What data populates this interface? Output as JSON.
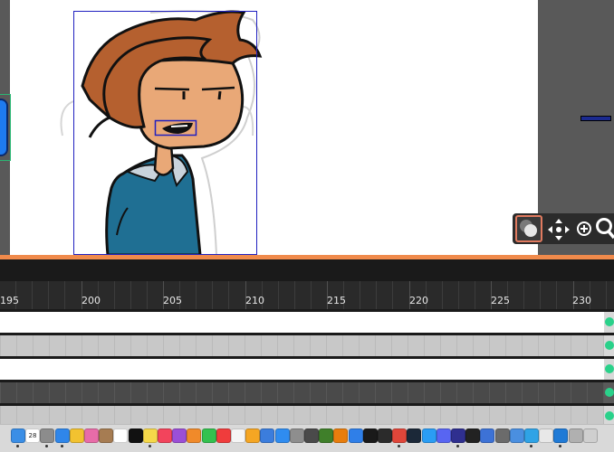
{
  "timeline": {
    "ruler_labels": [
      "195",
      "200",
      "205",
      "210",
      "215",
      "220",
      "225",
      "230"
    ]
  },
  "tracks": [
    "white",
    "grey",
    "white",
    "dark",
    "grey"
  ],
  "colors": {
    "accent": "#f08a4b",
    "keyframe": "#2ad18a",
    "selection": "#2020c0",
    "hair": "#b5602f",
    "skin": "#e9a877",
    "hoodie": "#1f6f93"
  },
  "tool_widget": {
    "icons": [
      "onion-skin-icon",
      "move-arrows-icon",
      "zoom-in-icon",
      "search-icon"
    ]
  },
  "dock": {
    "apps": [
      {
        "name": "finder-icon",
        "color": "#3a8ee6"
      },
      {
        "name": "calendar-icon",
        "color": "#ffffff",
        "text": "28"
      },
      {
        "name": "launchpad-icon",
        "color": "#8c8c8c"
      },
      {
        "name": "mail-icon",
        "color": "#2f86ea"
      },
      {
        "name": "chrome-icon",
        "color": "#f2c230"
      },
      {
        "name": "photos-icon",
        "color": "#e86ca8"
      },
      {
        "name": "notes-icon",
        "color": "#a67c52"
      },
      {
        "name": "reminders-icon",
        "color": "#ffffff"
      },
      {
        "name": "appletv-icon",
        "color": "#111111"
      },
      {
        "name": "stickies-icon",
        "color": "#f5d84a"
      },
      {
        "name": "music-icon",
        "color": "#f2445c"
      },
      {
        "name": "podcasts-icon",
        "color": "#9b4fd6"
      },
      {
        "name": "books-icon",
        "color": "#f08a2a"
      },
      {
        "name": "facetime-icon",
        "color": "#33c14f"
      },
      {
        "name": "news-icon",
        "color": "#f03c3c"
      },
      {
        "name": "script-icon",
        "color": "#f5f5f5"
      },
      {
        "name": "pages-icon",
        "color": "#f5a623"
      },
      {
        "name": "keynote-icon",
        "color": "#3b7ddd"
      },
      {
        "name": "appstore-icon",
        "color": "#2f8cf0"
      },
      {
        "name": "system-settings-icon",
        "color": "#8e8e8e"
      },
      {
        "name": "activity-icon",
        "color": "#4a4a4a"
      },
      {
        "name": "minecraft-icon",
        "color": "#3f7f2a"
      },
      {
        "name": "blender-icon",
        "color": "#e87d0d"
      },
      {
        "name": "bluetooth-icon",
        "color": "#2f7fe8"
      },
      {
        "name": "terminal-icon",
        "color": "#1a1a1a"
      },
      {
        "name": "tv-icon",
        "color": "#2b2b2b"
      },
      {
        "name": "chrome2-icon",
        "color": "#e0463a"
      },
      {
        "name": "steam-icon",
        "color": "#1b2838"
      },
      {
        "name": "safari-icon",
        "color": "#2a9df4"
      },
      {
        "name": "discord-icon",
        "color": "#5865f2"
      },
      {
        "name": "m-app-icon",
        "color": "#2f2f8f"
      },
      {
        "name": "figma-icon",
        "color": "#222222"
      },
      {
        "name": "c-app-icon",
        "color": "#3d72d6"
      },
      {
        "name": "gear-app-icon",
        "color": "#6b6b6b"
      },
      {
        "name": "preview-icon",
        "color": "#4a8fe0"
      },
      {
        "name": "s-app-icon",
        "color": "#2fa3e6"
      },
      {
        "name": "w-app-icon",
        "color": "#e8e8e8"
      },
      {
        "name": "vscode-icon",
        "color": "#1f7ad6"
      },
      {
        "name": "downloads-icon",
        "color": "#b0b0b0"
      },
      {
        "name": "trash-icon",
        "color": "#cfcfcf"
      }
    ]
  }
}
